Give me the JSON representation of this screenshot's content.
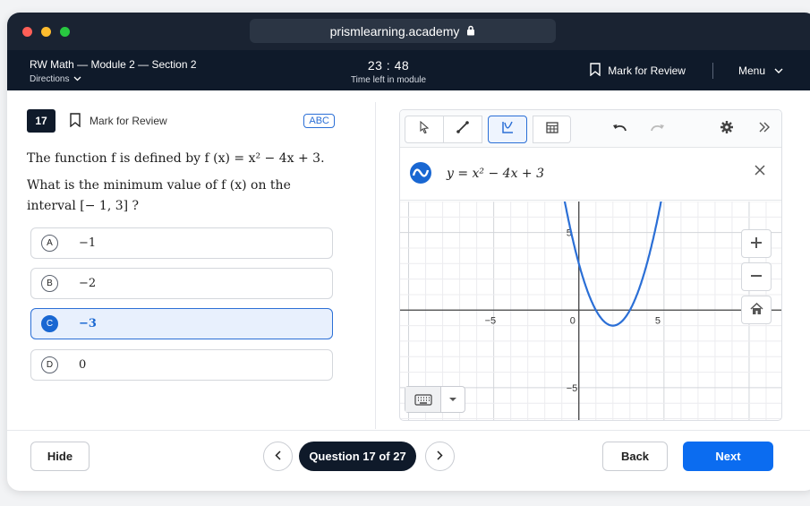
{
  "browser": {
    "url": "prismlearning.academy",
    "lock_icon": "lock-icon"
  },
  "header": {
    "section_title": "RW Math — Module 2 — Section 2",
    "directions_label": "Directions",
    "timer": "23 : 48",
    "timer_label": "Time left in module",
    "mark_label": "Mark for Review",
    "menu_label": "Menu"
  },
  "question": {
    "number": "17",
    "mark_label": "Mark for Review",
    "abc_label": "ABC",
    "stem": "The function f is defined by f (x) = x² − 4x + 3.",
    "prompt": "What is the minimum value of f (x) on the interval [− 1, 3] ?",
    "choices": [
      {
        "letter": "A",
        "text": "−1",
        "selected": false
      },
      {
        "letter": "B",
        "text": "−2",
        "selected": false
      },
      {
        "letter": "C",
        "text": "−3",
        "selected": true
      },
      {
        "letter": "D",
        "text": "0",
        "selected": false
      }
    ]
  },
  "calculator": {
    "tools": [
      "pointer-icon",
      "line-tool-icon",
      "graph-tool-icon",
      "table-icon",
      "undo-icon",
      "redo-icon",
      "settings-icon",
      "expand-icon"
    ],
    "expression": "y = x² − 4x + 3",
    "graph": {
      "x_ticks": [
        "−5",
        "0",
        "5"
      ],
      "y_ticks": [
        "5",
        "−5"
      ],
      "curve": {
        "a": 1,
        "b": -4,
        "c": 3
      },
      "xlim": [
        -10.5,
        12
      ],
      "ylim": [
        -7.2,
        7
      ]
    },
    "accent": "#2b6fd6"
  },
  "footer": {
    "hide_label": "Hide",
    "question_pill": "Question 17 of 27",
    "back_label": "Back",
    "next_label": "Next"
  }
}
